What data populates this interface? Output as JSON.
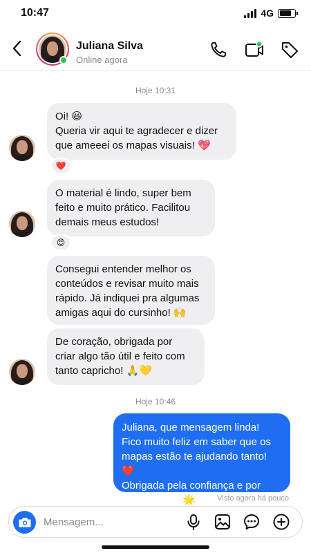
{
  "status_bar": {
    "time": "10:47",
    "network": "4G",
    "battery_level": 0.8
  },
  "header": {
    "contact_name": "Juliana Silva",
    "contact_status": "Online agora",
    "icons": [
      "back-arrow-icon",
      "phone-icon",
      "video-camera-icon",
      "tag-icon"
    ]
  },
  "conversation": {
    "timestamp_1": "Hoje 10:31",
    "timestamp_2": "Hoje 10:46",
    "messages": [
      {
        "from": "contact",
        "text": "Oi! 😃\nQueria vir aqui te agradecer e dizer\nque ameeei os mapas visuais! 💖",
        "reaction": "❤️"
      },
      {
        "from": "contact",
        "text": "O material é lindo, super bem\nfeito e muito prático. Facilitou\ndemais meus estudos!",
        "reaction": "😍"
      },
      {
        "from": "contact",
        "text": "Consegui entender melhor os\nconteúdos e revisar muito mais\nrápido. Já indiquei pra algumas\namigas aqui do cursinho! 🙌"
      },
      {
        "from": "contact",
        "text": "De coração, obrigada por\ncriar algo tão útil e feito com\ntanto capricho! 🙏💛"
      },
      {
        "from": "me",
        "text": "Juliana, que mensagem linda!\nFico muito feliz em saber que os\nmapas estão te ajudando tanto! ❤️\nObrigada pela confiança e por\nrecomendar! 🌟"
      }
    ],
    "seen_status": "Visto agora há pouco"
  },
  "composer": {
    "placeholder": "Mensagem...",
    "icons": [
      "camera-icon",
      "microphone-icon",
      "image-icon",
      "sticker-icon",
      "plus-icon"
    ]
  },
  "colors": {
    "accent": "#1f6ef2",
    "incoming_bubble": "#efeff1",
    "online": "#2cc84b"
  }
}
